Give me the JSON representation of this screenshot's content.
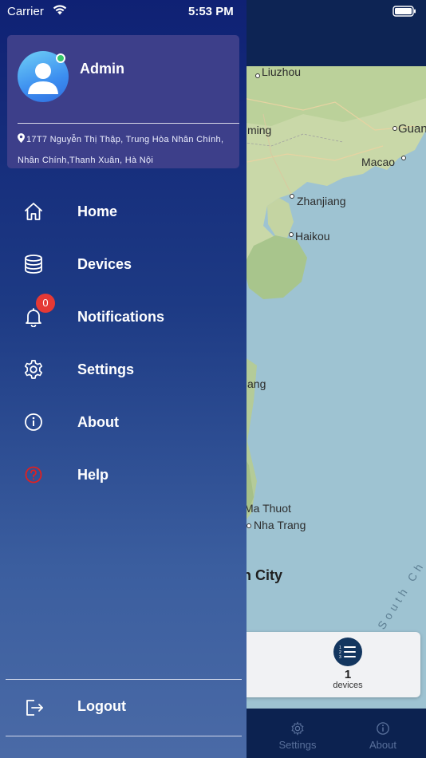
{
  "status_bar": {
    "carrier": "Carrier",
    "time": "5:53 PM"
  },
  "profile": {
    "name": "Admin",
    "online": true,
    "address": "17T7 Nguyễn Thị Thập, Trung Hòa Nhân Chính, Nhân Chính,Thanh Xuân, Hà Nội"
  },
  "menu": {
    "items": [
      {
        "label": "Home",
        "icon": "home-icon"
      },
      {
        "label": "Devices",
        "icon": "database-icon"
      },
      {
        "label": "Notifications",
        "icon": "bell-icon",
        "badge": "0"
      },
      {
        "label": "Settings",
        "icon": "gear-icon"
      },
      {
        "label": "About",
        "icon": "info-icon"
      },
      {
        "label": "Help",
        "icon": "help-circle-icon"
      }
    ],
    "logout_label": "Logout"
  },
  "map": {
    "labels": [
      "Liuzhou",
      "ming",
      "Guan",
      "Macao",
      "Zhanjiang",
      "Haikou",
      "ang",
      "Ma Thuot",
      "Nha Trang",
      "n City"
    ],
    "sea_label": "South Ch"
  },
  "device_summary": {
    "count": "1",
    "unit": "devices"
  },
  "tabbar": {
    "items": [
      {
        "label": "Settings",
        "icon": "gear-icon"
      },
      {
        "label": "About",
        "icon": "info-icon"
      }
    ]
  },
  "colors": {
    "drawer_top": "#0f2174",
    "drawer_bottom": "#4a6aa6",
    "profile_card": "#3d3f8a",
    "badge_red": "#e53935",
    "online_green": "#37c96b",
    "help_red": "#e02020"
  }
}
